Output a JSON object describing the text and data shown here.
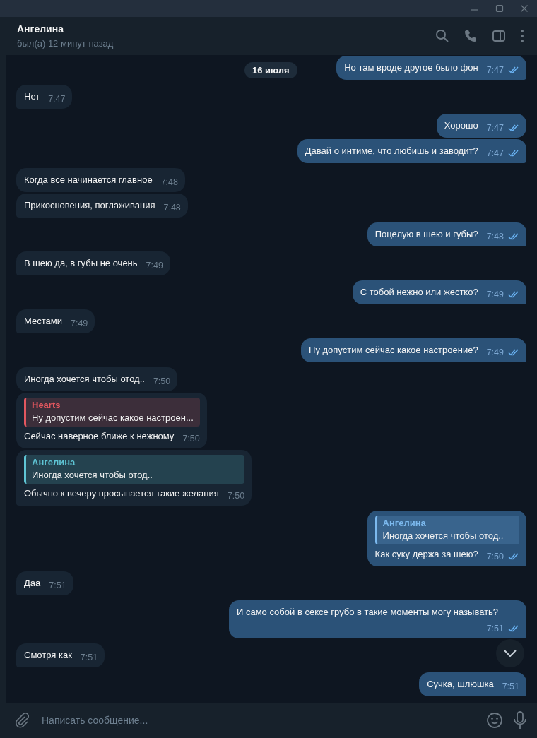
{
  "header": {
    "name": "Ангелина",
    "status": "был(а) 12 минут назад"
  },
  "date_badge": "16 июля",
  "groups": [
    {
      "kind": "out",
      "messages": [
        {
          "text": "Но там вроде другое было фон",
          "time": "7:47",
          "read": true
        }
      ]
    },
    {
      "kind": "in",
      "messages": [
        {
          "text": "Нет",
          "time": "7:47"
        }
      ]
    },
    {
      "kind": "out",
      "messages": [
        {
          "text": "Хорошо",
          "time": "7:47",
          "read": true
        },
        {
          "text": "Давай о интиме, что любишь и заводит?",
          "time": "7:47",
          "read": true
        }
      ]
    },
    {
      "kind": "in",
      "messages": [
        {
          "text": "Когда все начинается главное",
          "time": "7:48"
        },
        {
          "text": "Прикосновения, поглаживания",
          "time": "7:48"
        }
      ]
    },
    {
      "kind": "out",
      "messages": [
        {
          "text": "Поцелую в шею и губы?",
          "time": "7:48",
          "read": true
        }
      ]
    },
    {
      "kind": "in",
      "messages": [
        {
          "text": "В шею да, в губы не очень",
          "time": "7:49"
        }
      ]
    },
    {
      "kind": "out",
      "messages": [
        {
          "text": "С тобой нежно или жестко?",
          "time": "7:49",
          "read": true
        }
      ]
    },
    {
      "kind": "in",
      "messages": [
        {
          "text": "Местами",
          "time": "7:49"
        }
      ]
    },
    {
      "kind": "out",
      "messages": [
        {
          "text": "Ну допустим сейчас какое настроение?",
          "time": "7:49",
          "read": true
        }
      ]
    },
    {
      "kind": "in",
      "messages": [
        {
          "text": "Иногда хочется чтобы отод..",
          "time": "7:50"
        },
        {
          "reply": {
            "author": "Hearts",
            "text": "Ну допустим сейчас какое настроен...",
            "color": "#e2575f"
          },
          "text": "Сейчас наверное ближе к нежному",
          "time": "7:50"
        },
        {
          "reply": {
            "author": "Ангелина",
            "text": "Иногда хочется чтобы отод..",
            "color": "#5fc5d5"
          },
          "text": "Обычно к вечеру просыпается такие желания",
          "time": "7:50"
        }
      ]
    },
    {
      "kind": "out",
      "messages": [
        {
          "reply": {
            "author": "Ангелина",
            "text": "Иногда хочется чтобы отод..",
            "color": "#7cb9ee"
          },
          "text": "Как суку держа за шею?",
          "time": "7:50",
          "read": true
        }
      ]
    },
    {
      "kind": "in",
      "messages": [
        {
          "text": "Даа",
          "time": "7:51"
        }
      ]
    },
    {
      "kind": "out",
      "messages": [
        {
          "text": "И само собой в сексе грубо в такие моменты могу называть?",
          "time": "7:51",
          "read": true
        }
      ]
    },
    {
      "kind": "in",
      "messages": [
        {
          "text": "Смотря как",
          "time": "7:51"
        }
      ]
    },
    {
      "kind": "out",
      "messages": [
        {
          "text": "Сучка, шлюшка",
          "time": "7:51"
        }
      ]
    }
  ],
  "composer": {
    "placeholder": "Написать сообщение..."
  }
}
